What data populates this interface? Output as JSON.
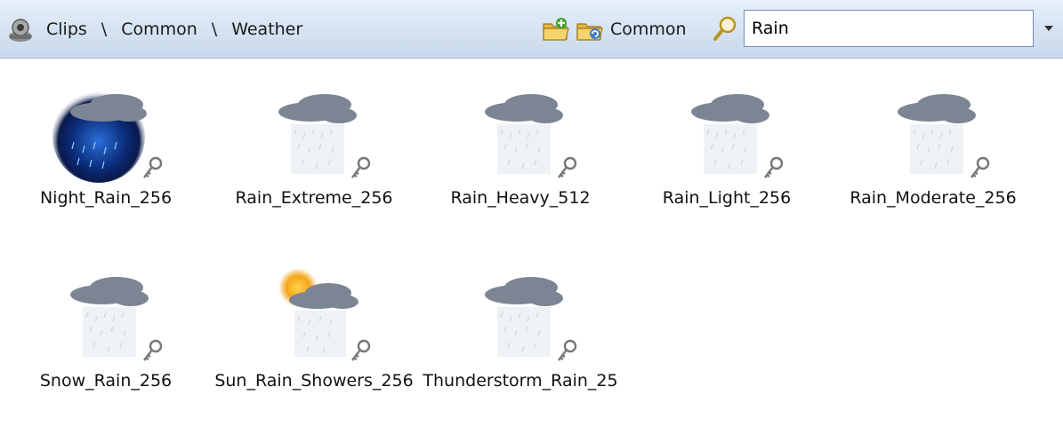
{
  "toolbar": {
    "clips_icon": "clips-library-icon",
    "breadcrumb": [
      "Clips",
      "Common",
      "Weather"
    ],
    "separator": "\\",
    "import_icon": "folder-add-icon",
    "collection_icon": "folder-refresh-icon",
    "collection_label": "Common",
    "search_icon": "magnifier-icon",
    "search_value": "Rain",
    "dropdown_icon": "chevron-down-icon"
  },
  "clips": [
    {
      "name": "Night_Rain_256",
      "variant": "night"
    },
    {
      "name": "Rain_Extreme_256",
      "variant": "rain"
    },
    {
      "name": "Rain_Heavy_512",
      "variant": "rain"
    },
    {
      "name": "Rain_Light_256",
      "variant": "rain"
    },
    {
      "name": "Rain_Moderate_256",
      "variant": "rain"
    },
    {
      "name": "Snow_Rain_256",
      "variant": "rain"
    },
    {
      "name": "Sun_Rain_Showers_256",
      "variant": "sun"
    },
    {
      "name": "Thunderstorm_Rain_25",
      "variant": "rain"
    }
  ],
  "colors": {
    "toolbar_top": "#e9f1fb",
    "toolbar_bottom": "#c9d9ec",
    "cloud": "#7c8593",
    "night_sky": "#0b2a78",
    "sun": "#f5a51e"
  }
}
